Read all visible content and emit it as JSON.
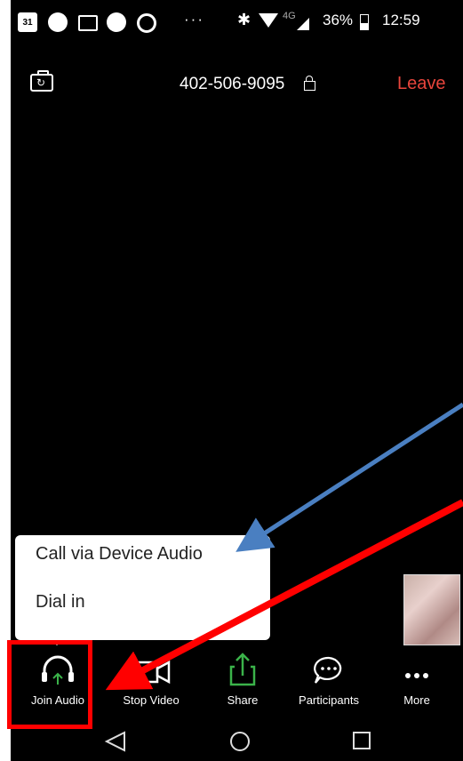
{
  "status_bar": {
    "calendar_day": "31",
    "dots": "···",
    "lte_label": "4G",
    "battery_percent": "36%",
    "time": "12:59"
  },
  "meeting": {
    "meeting_id": "402-506-9095",
    "leave_label": "Leave",
    "leave_color": "#e8453c"
  },
  "audio_menu": {
    "items": [
      {
        "label": "Call via Device Audio"
      },
      {
        "label": "Dial in"
      }
    ]
  },
  "toolbar": {
    "join_audio_label": "Join Audio",
    "stop_video_label": "Stop Video",
    "share_label": "Share",
    "participants_label": "Participants",
    "more_label": "More"
  },
  "icons": {
    "camera_switch": "camera-switch-icon",
    "lock": "lock-icon",
    "headphones": "headphones-icon",
    "video_camera": "video-camera-icon",
    "share": "share-icon",
    "chat_bubble": "chat-bubble-icon",
    "more": "ellipsis-icon",
    "back": "back-triangle-icon",
    "home": "home-circle-icon",
    "recents": "recents-square-icon"
  },
  "colors": {
    "share_green": "#3bb34a",
    "annotation_red": "#ff0000",
    "annotation_blue": "#4a7fc1"
  }
}
